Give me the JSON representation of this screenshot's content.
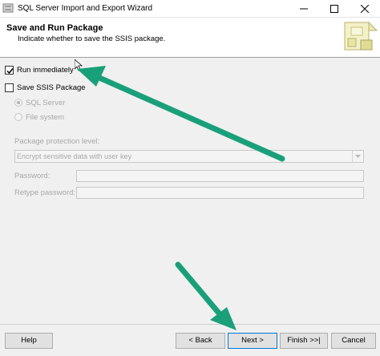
{
  "window": {
    "title": "SQL Server Import and Export Wizard"
  },
  "header": {
    "title": "Save and Run Package",
    "subtitle": "Indicate whether to save the SSIS package."
  },
  "options": {
    "run_immediately": {
      "label": "Run immediately",
      "checked": true
    },
    "save_ssis": {
      "label": "Save SSIS Package",
      "checked": false
    },
    "radio_sql_server": {
      "label": "SQL Server",
      "selected": true
    },
    "radio_file_system": {
      "label": "File system",
      "selected": false
    }
  },
  "protection": {
    "label": "Package protection level:",
    "selected": "Encrypt sensitive data with user key"
  },
  "password": {
    "label": "Password:",
    "value": ""
  },
  "retype_password": {
    "label": "Retype password:",
    "value": ""
  },
  "buttons": {
    "help": "Help",
    "back": "< Back",
    "next": "Next >",
    "finish": "Finish >>|",
    "cancel": "Cancel"
  },
  "colors": {
    "annotation_arrow": "#1aa079",
    "default_button_border": "#0078d7"
  }
}
